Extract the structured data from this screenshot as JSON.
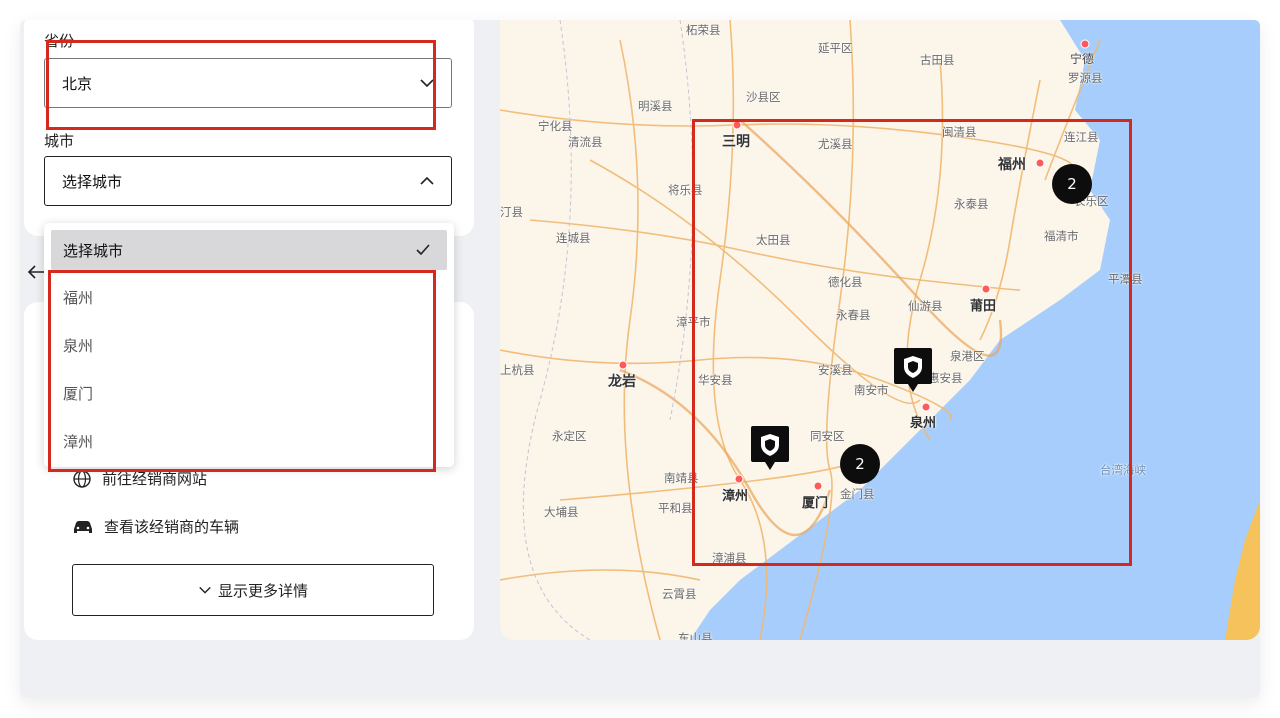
{
  "filters": {
    "province_label": "省份",
    "province_value": "北京",
    "city_label": "城市",
    "city_placeholder": "选择城市"
  },
  "dropdown": {
    "selected": "选择城市",
    "options": [
      "福州",
      "泉州",
      "厦门",
      "漳州"
    ]
  },
  "dealer_actions": {
    "website": "前往经销商网站",
    "vehicles": "查看该经销商的车辆",
    "more_details": "显示更多详情"
  },
  "map": {
    "labels": [
      "柘荣县",
      "宁德",
      "延平区",
      "古田县",
      "罗源县",
      "明溪县",
      "沙县区",
      "宁化县",
      "清流县",
      "三明",
      "尤溪县",
      "闽清县",
      "福州",
      "连江县",
      "将乐县",
      "永泰县",
      "长乐区",
      "汀县",
      "连城县",
      "太田县",
      "福清市",
      "平潭县",
      "德化县",
      "仙游县",
      "莆田",
      "漳平市",
      "永春县",
      "泉港区",
      "上杭县",
      "龙岩",
      "华安县",
      "安溪县",
      "南安市",
      "惠安县",
      "泉州",
      "永定区",
      "同安区",
      "南靖县",
      "漳州",
      "厦门",
      "金门县",
      "台湾海峡",
      "大埔县",
      "平和县",
      "漳浦县",
      "云霄县",
      "东山县"
    ],
    "clusters": [
      "2",
      "2"
    ],
    "colors": {
      "land": "#fbf5ea",
      "sea": "#a6cdfb",
      "road": "#f2b770",
      "highlight": "#d42a1e"
    }
  }
}
